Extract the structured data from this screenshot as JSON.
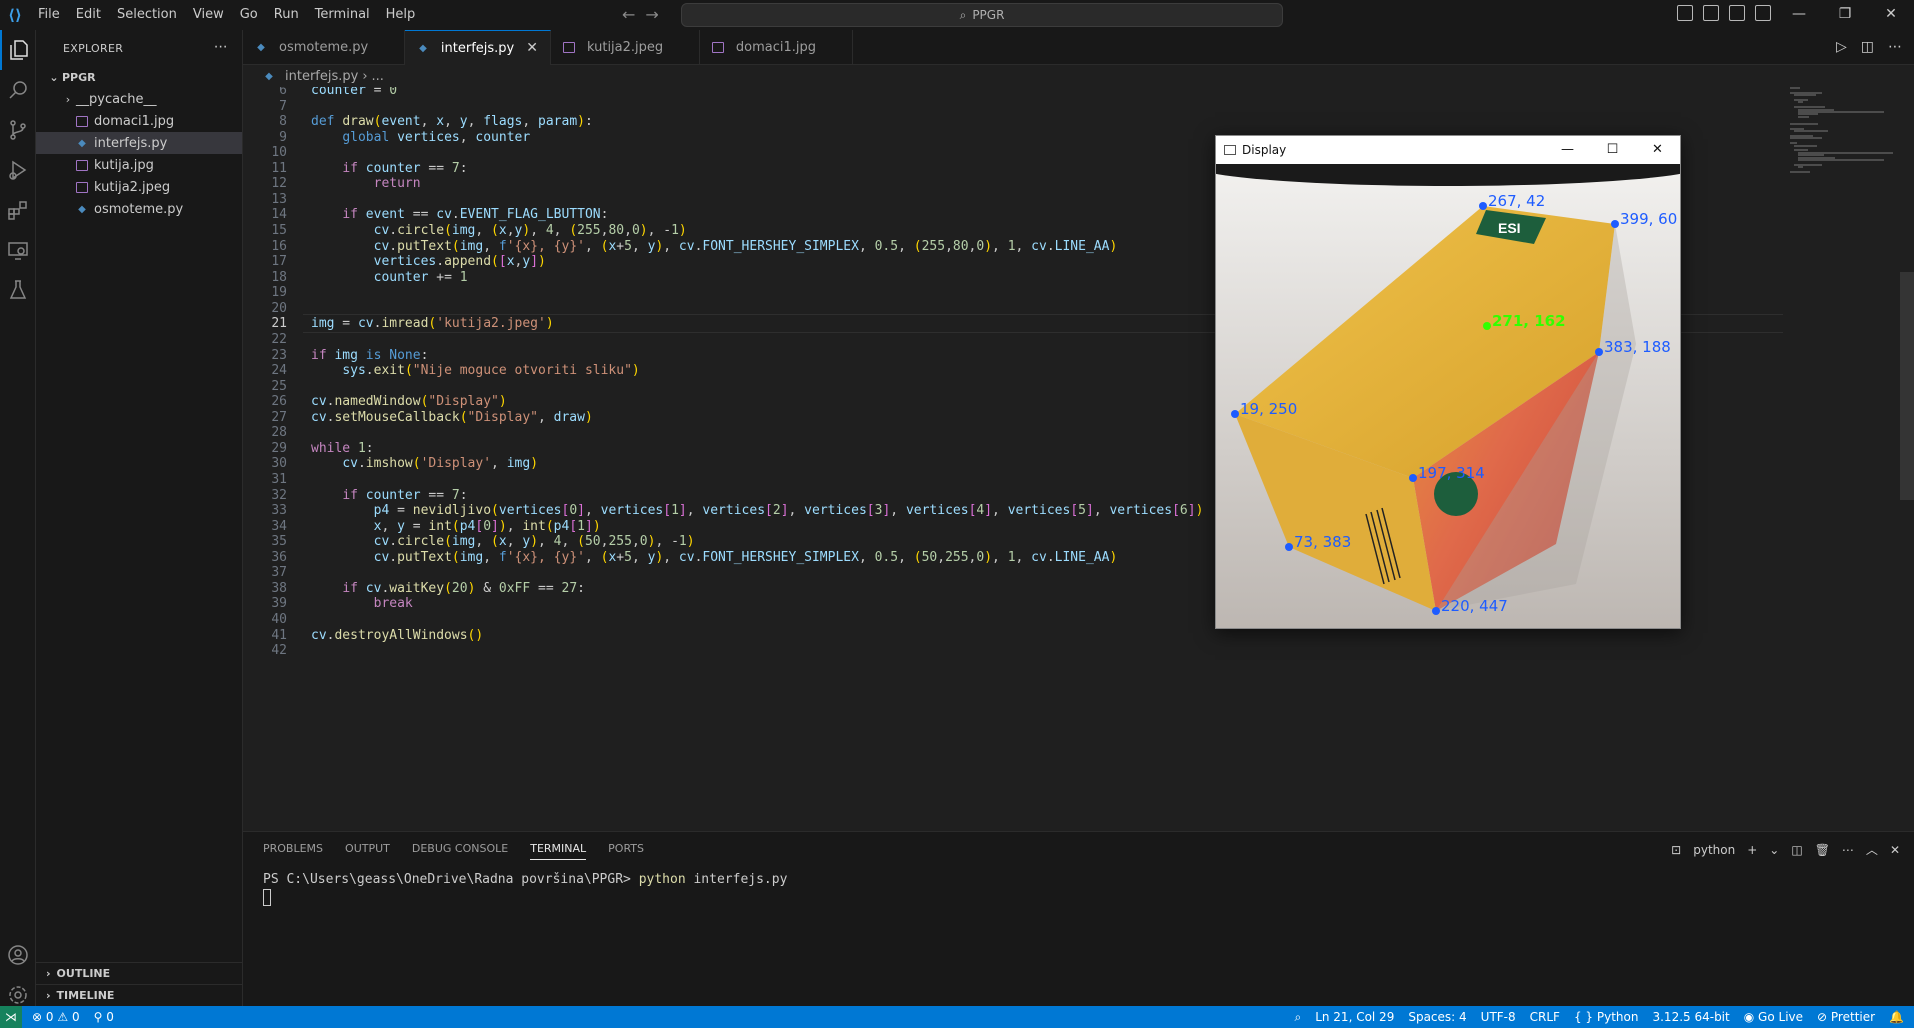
{
  "titlebar": {
    "menu": [
      "File",
      "Edit",
      "Selection",
      "View",
      "Go",
      "Run",
      "Terminal",
      "Help"
    ],
    "search": "PPGR"
  },
  "explorer": {
    "title": "EXPLORER",
    "folder": "PPGR",
    "items": [
      {
        "name": "__pycache__",
        "type": "folder"
      },
      {
        "name": "domaci1.jpg",
        "type": "image"
      },
      {
        "name": "interfejs.py",
        "type": "python",
        "selected": true
      },
      {
        "name": "kutija.jpg",
        "type": "image"
      },
      {
        "name": "kutija2.jpeg",
        "type": "image"
      },
      {
        "name": "osmoteme.py",
        "type": "python"
      }
    ],
    "outline": "OUTLINE",
    "timeline": "TIMELINE"
  },
  "tabs": [
    {
      "label": "osmoteme.py",
      "type": "python"
    },
    {
      "label": "interfejs.py",
      "type": "python",
      "active": true
    },
    {
      "label": "kutija2.jpeg",
      "type": "image"
    },
    {
      "label": "domaci1.jpg",
      "type": "image"
    }
  ],
  "breadcrumb": {
    "file": "interfejs.py",
    "rest": "..."
  },
  "editor": {
    "current_line": 21,
    "lines": [
      {
        "n": "6",
        "t": "counter = 0"
      },
      {
        "n": "7",
        "t": ""
      },
      {
        "n": "8",
        "t": "def draw(event, x, y, flags, param):"
      },
      {
        "n": "9",
        "t": "    global vertices, counter"
      },
      {
        "n": "10",
        "t": ""
      },
      {
        "n": "11",
        "t": "    if counter == 7:"
      },
      {
        "n": "12",
        "t": "        return"
      },
      {
        "n": "13",
        "t": ""
      },
      {
        "n": "14",
        "t": "    if event == cv.EVENT_FLAG_LBUTTON:"
      },
      {
        "n": "15",
        "t": "        cv.circle(img, (x,y), 4, (255,80,0), -1)"
      },
      {
        "n": "16",
        "t": "        cv.putText(img, f'{x}, {y}', (x+5, y), cv.FONT_HERSHEY_SIMPLEX, 0.5, (255,80,0), 1, cv.LINE_AA)"
      },
      {
        "n": "17",
        "t": "        vertices.append([x,y])"
      },
      {
        "n": "18",
        "t": "        counter += 1"
      },
      {
        "n": "19",
        "t": ""
      },
      {
        "n": "20",
        "t": ""
      },
      {
        "n": "21",
        "t": "img = cv.imread('kutija2.jpeg')"
      },
      {
        "n": "22",
        "t": ""
      },
      {
        "n": "23",
        "t": "if img is None:"
      },
      {
        "n": "24",
        "t": "    sys.exit(\"Nije moguce otvoriti sliku\")"
      },
      {
        "n": "25",
        "t": ""
      },
      {
        "n": "26",
        "t": "cv.namedWindow(\"Display\")"
      },
      {
        "n": "27",
        "t": "cv.setMouseCallback(\"Display\", draw)"
      },
      {
        "n": "28",
        "t": ""
      },
      {
        "n": "29",
        "t": "while 1:"
      },
      {
        "n": "30",
        "t": "    cv.imshow('Display', img)"
      },
      {
        "n": "31",
        "t": ""
      },
      {
        "n": "32",
        "t": "    if counter == 7:"
      },
      {
        "n": "33",
        "t": "        p4 = nevidljivo(vertices[0], vertices[1], vertices[2], vertices[3], vertices[4], vertices[5], vertices[6])"
      },
      {
        "n": "34",
        "t": "        x, y = int(p4[0]), int(p4[1])"
      },
      {
        "n": "35",
        "t": "        cv.circle(img, (x, y), 4, (50,255,0), -1)"
      },
      {
        "n": "36",
        "t": "        cv.putText(img, f'{x}, {y}', (x+5, y), cv.FONT_HERSHEY_SIMPLEX, 0.5, (50,255,0), 1, cv.LINE_AA)"
      },
      {
        "n": "37",
        "t": ""
      },
      {
        "n": "38",
        "t": "    if cv.waitKey(20) & 0xFF == 27:"
      },
      {
        "n": "39",
        "t": "        break"
      },
      {
        "n": "40",
        "t": ""
      },
      {
        "n": "41",
        "t": "cv.destroyAllWindows()"
      },
      {
        "n": "42",
        "t": ""
      }
    ]
  },
  "cv_window": {
    "title": "Display",
    "points_blue": [
      {
        "label": "267, 42"
      },
      {
        "label": "399, 60"
      },
      {
        "label": "383, 188"
      },
      {
        "label": "19, 250"
      },
      {
        "label": "197, 314"
      },
      {
        "label": "73, 383"
      },
      {
        "label": "220, 447"
      }
    ],
    "point_green": {
      "label": "271, 162"
    },
    "box_brand": "ESI"
  },
  "panel": {
    "tabs": [
      "PROBLEMS",
      "OUTPUT",
      "DEBUG CONSOLE",
      "TERMINAL",
      "PORTS"
    ],
    "active_tab": "TERMINAL",
    "shell_label": "python",
    "prompt": "PS C:\\Users\\geass\\OneDrive\\Radna površina\\PPGR>",
    "command": "python",
    "command_arg": " interfejs.py"
  },
  "statusbar": {
    "errors": "0",
    "warnings": "0",
    "ports": "0",
    "position": "Ln 21, Col 29",
    "spaces": "Spaces: 4",
    "encoding": "UTF-8",
    "eol": "CRLF",
    "language": "Python",
    "interpreter": "3.12.5 64-bit",
    "golive": "Go Live",
    "prettier": "Prettier"
  },
  "colors": {
    "accent": "#0078d4",
    "point_blue": "#1e5cff",
    "point_green": "#32ff00"
  }
}
